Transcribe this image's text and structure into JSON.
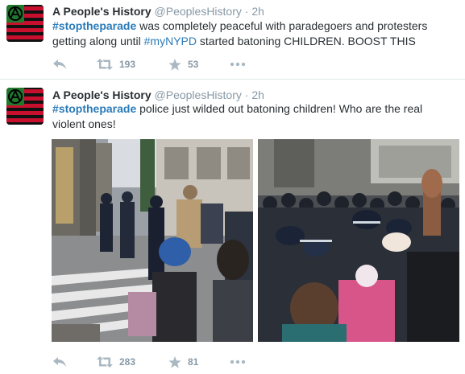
{
  "tweets": [
    {
      "author": {
        "name": "A People's History",
        "handle": "@PeoplesHistory"
      },
      "separator": "·",
      "time": "2h",
      "text": {
        "hashtag": "#stoptheparade",
        "part1": " was completely peaceful with paradegoers and protesters getting along until ",
        "mention": "#myNYPD",
        "part2": " started batoning CHILDREN. BOOST THIS"
      },
      "stats": {
        "retweets": "193",
        "favorites": "53"
      }
    },
    {
      "author": {
        "name": "A People's History",
        "handle": "@PeoplesHistory"
      },
      "separator": "·",
      "time": "2h",
      "text": {
        "hashtag": "#stoptheparade",
        "part1": " police just wilded out batoning children!  Who are the real violent ones!"
      },
      "photos": [
        "street-protest-photo",
        "police-crowd-photo"
      ],
      "stats": {
        "retweets": "283",
        "favorites": "81"
      }
    }
  ],
  "icons": [
    "reply-icon",
    "retweet-icon",
    "favorite-star-icon",
    "more-icon"
  ],
  "colors": {
    "link": "#2b7bb9",
    "muted": "#8899a6",
    "text": "#292f33",
    "avatar_red": "#c8102e",
    "avatar_green": "#1f7a2e"
  }
}
